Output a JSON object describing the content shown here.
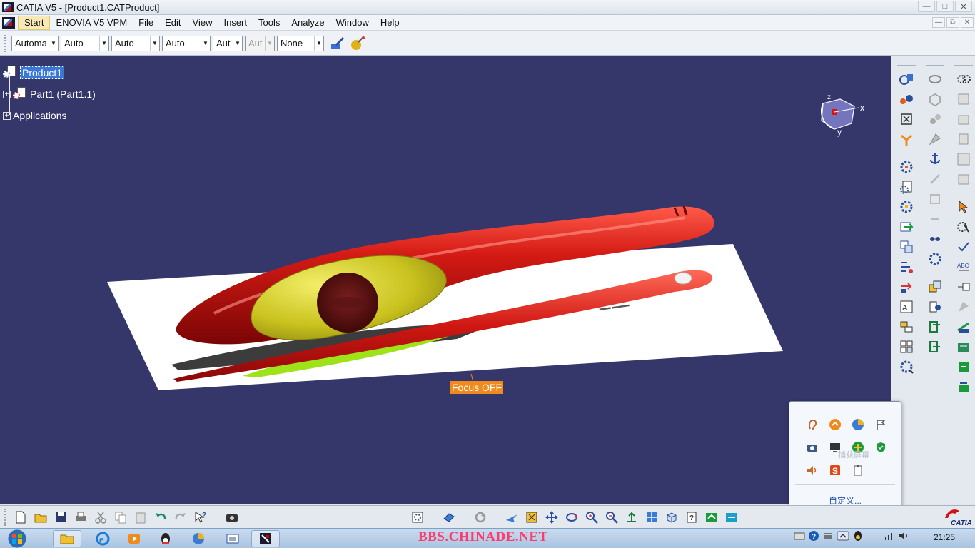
{
  "window": {
    "title": "CATIA V5 - [Product1.CATProduct]"
  },
  "menubar": {
    "items": [
      {
        "label": "Start",
        "accel": "S"
      },
      {
        "label": "ENOVIA V5 VPM",
        "accel": ""
      },
      {
        "label": "File",
        "accel": "F"
      },
      {
        "label": "Edit",
        "accel": "E"
      },
      {
        "label": "View",
        "accel": "V"
      },
      {
        "label": "Insert",
        "accel": "I"
      },
      {
        "label": "Tools",
        "accel": "T"
      },
      {
        "label": "Analyze",
        "accel": "A"
      },
      {
        "label": "Window",
        "accel": "W"
      },
      {
        "label": "Help",
        "accel": "H"
      }
    ]
  },
  "properties": {
    "combo1": "Automa",
    "combo2": "Auto",
    "combo3": "Auto",
    "combo4": "Auto",
    "combo5": "Aut",
    "combo6": "Aut",
    "combo7": "None"
  },
  "tree": {
    "root": "Product1",
    "child": "Part1 (Part1.1)",
    "applications": "Applications"
  },
  "compass": {
    "x_label": "x",
    "y_label": "y",
    "z_label": "z"
  },
  "focus_tag": "Focus OFF",
  "tray_popup": {
    "hint": "捕获屏幕",
    "customize": "自定义..."
  },
  "taskbar": {
    "watermark": "BBS.CHINADE.NET",
    "clock": "21:25"
  },
  "colors": {
    "viewport_bg": "#35366a",
    "model_red": "#c81414",
    "model_yellow": "#c9c21e",
    "focus_tag": "#f08a1c"
  }
}
